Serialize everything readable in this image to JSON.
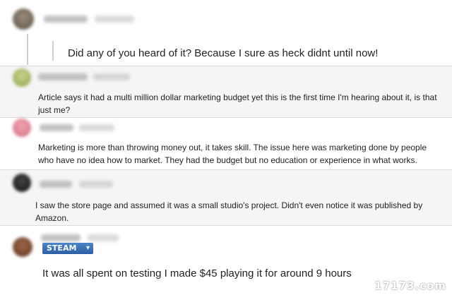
{
  "comments": [
    {
      "text": "Did any of you heard of it? Because I sure as heck didnt until now!"
    },
    {
      "text_line1": "Article says it had a multi million dollar marketing budget yet this is the first time I'm hearing about it, is that",
      "text_line2": "just me?"
    },
    {
      "text_line1": "Marketing is more than throwing money out, it takes skill. The issue here was marketing done by people",
      "text_line2": "who have no idea how to market. They had the budget but no education or experience in what works."
    },
    {
      "text_line1": "I saw the store page and assumed it was a small studio's project. Didn't even notice it was published by",
      "text_line2": "Amazon."
    },
    {
      "badge": "STEAM",
      "text": "It was all spent on testing I made $45 playing it for around 9 hours"
    }
  ],
  "watermark": "17173.com",
  "colors": {
    "panel": "#f5f5f5",
    "separator": "#dcdcdc",
    "badge": "#2a5fa6"
  }
}
